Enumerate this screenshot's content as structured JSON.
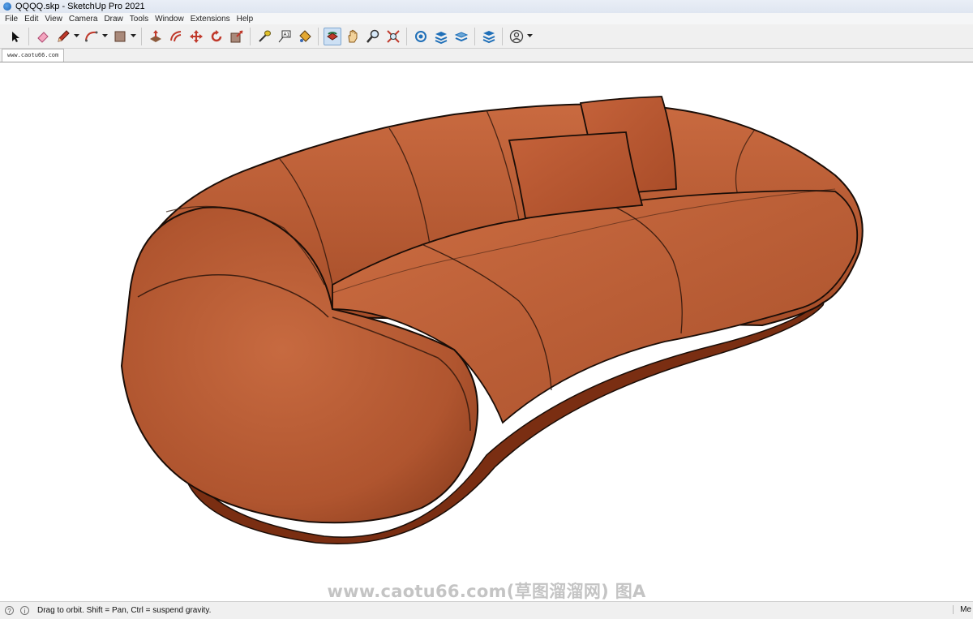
{
  "window": {
    "title": "QQQQ.skp - SketchUp Pro 2021"
  },
  "menu": [
    "File",
    "Edit",
    "View",
    "Camera",
    "Draw",
    "Tools",
    "Window",
    "Extensions",
    "Help"
  ],
  "toolbar": {
    "tools": [
      "select-icon",
      "eraser-icon",
      "pencil-icon",
      "arc-icon",
      "rectangle-icon",
      "push-pull-icon",
      "offset-icon",
      "move-icon",
      "rotate-icon",
      "scale-icon",
      "tape-measure-icon",
      "text-icon",
      "paint-bucket-icon",
      "orbit-icon",
      "pan-icon",
      "zoom-icon",
      "zoom-extents-icon",
      "warehouse-icon",
      "extension-warehouse-icon",
      "layout-icon",
      "extension-manager-icon",
      "account-icon"
    ],
    "active_tool": "orbit-icon"
  },
  "scene_tab": {
    "label": "www.caotu66.com"
  },
  "watermark": {
    "text": "www.caotu66.com(草图溜溜网) 图A"
  },
  "status": {
    "message": "Drag to orbit. Shift = Pan, Ctrl = suspend gravity.",
    "right_text": "Me"
  },
  "colors": {
    "sofa_main": "#b5562f",
    "sofa_light": "#cf6e45",
    "sofa_dark": "#8a3c1e",
    "sofa_base": "#7a2e12",
    "outline": "#1a0d07",
    "toolbar_bg": "#f0f0f0",
    "active_bg": "#cde0f4"
  }
}
